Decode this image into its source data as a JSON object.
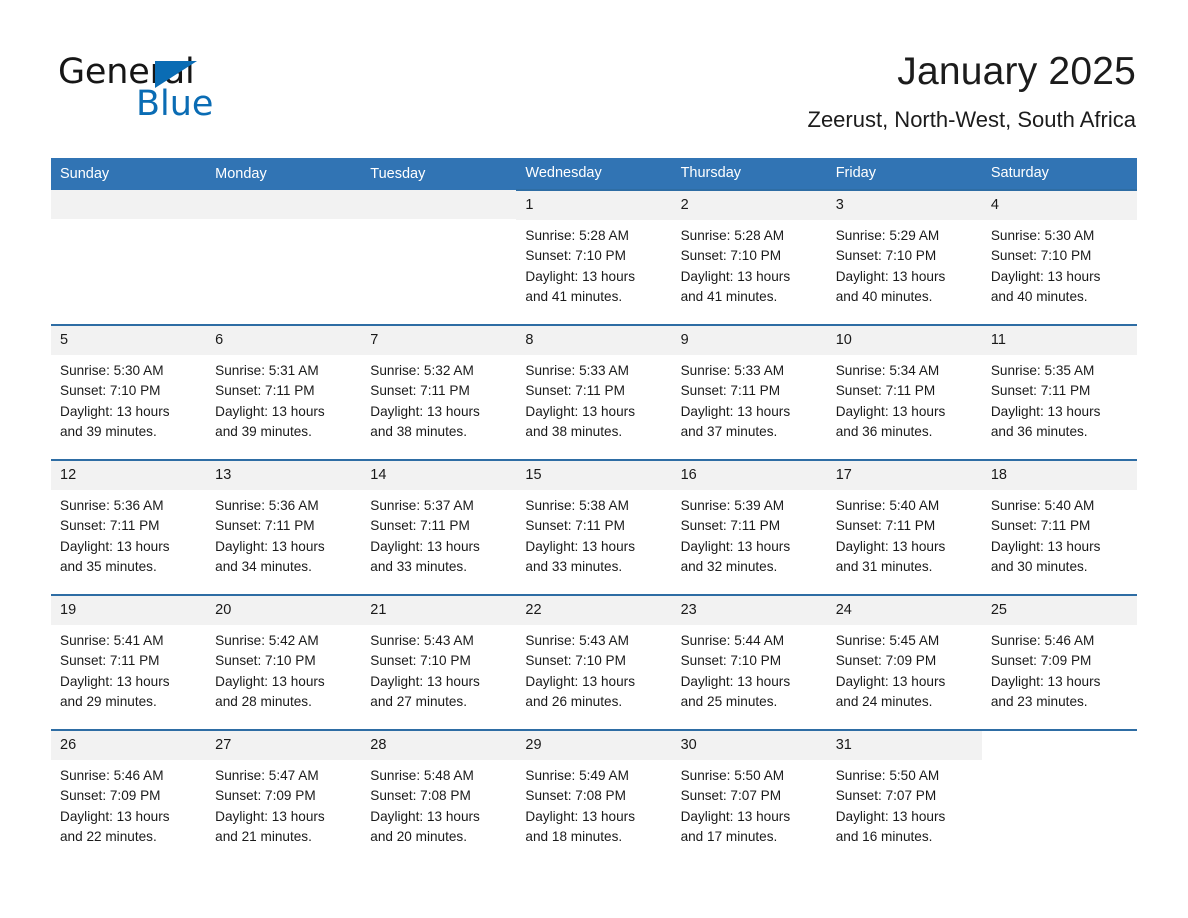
{
  "brand": {
    "name_part1": "General",
    "name_part2": "Blue",
    "logo_icon": "triangle-flag-icon",
    "primary_color": "#0a6cb4"
  },
  "header": {
    "title": "January 2025",
    "subtitle": "Zeerust, North-West, South Africa"
  },
  "theme": {
    "header_blue": "#3174b4",
    "row_rule_blue": "#2e6da4",
    "daynum_band": "#f2f2f2"
  },
  "calendar": {
    "weekday_headers": [
      "Sunday",
      "Monday",
      "Tuesday",
      "Wednesday",
      "Thursday",
      "Friday",
      "Saturday"
    ],
    "weeks": [
      [
        {
          "day": "",
          "lines": []
        },
        {
          "day": "",
          "lines": []
        },
        {
          "day": "",
          "lines": []
        },
        {
          "day": "1",
          "lines": [
            "Sunrise: 5:28 AM",
            "Sunset: 7:10 PM",
            "Daylight: 13 hours",
            "and 41 minutes."
          ]
        },
        {
          "day": "2",
          "lines": [
            "Sunrise: 5:28 AM",
            "Sunset: 7:10 PM",
            "Daylight: 13 hours",
            "and 41 minutes."
          ]
        },
        {
          "day": "3",
          "lines": [
            "Sunrise: 5:29 AM",
            "Sunset: 7:10 PM",
            "Daylight: 13 hours",
            "and 40 minutes."
          ]
        },
        {
          "day": "4",
          "lines": [
            "Sunrise: 5:30 AM",
            "Sunset: 7:10 PM",
            "Daylight: 13 hours",
            "and 40 minutes."
          ]
        }
      ],
      [
        {
          "day": "5",
          "lines": [
            "Sunrise: 5:30 AM",
            "Sunset: 7:10 PM",
            "Daylight: 13 hours",
            "and 39 minutes."
          ]
        },
        {
          "day": "6",
          "lines": [
            "Sunrise: 5:31 AM",
            "Sunset: 7:11 PM",
            "Daylight: 13 hours",
            "and 39 minutes."
          ]
        },
        {
          "day": "7",
          "lines": [
            "Sunrise: 5:32 AM",
            "Sunset: 7:11 PM",
            "Daylight: 13 hours",
            "and 38 minutes."
          ]
        },
        {
          "day": "8",
          "lines": [
            "Sunrise: 5:33 AM",
            "Sunset: 7:11 PM",
            "Daylight: 13 hours",
            "and 38 minutes."
          ]
        },
        {
          "day": "9",
          "lines": [
            "Sunrise: 5:33 AM",
            "Sunset: 7:11 PM",
            "Daylight: 13 hours",
            "and 37 minutes."
          ]
        },
        {
          "day": "10",
          "lines": [
            "Sunrise: 5:34 AM",
            "Sunset: 7:11 PM",
            "Daylight: 13 hours",
            "and 36 minutes."
          ]
        },
        {
          "day": "11",
          "lines": [
            "Sunrise: 5:35 AM",
            "Sunset: 7:11 PM",
            "Daylight: 13 hours",
            "and 36 minutes."
          ]
        }
      ],
      [
        {
          "day": "12",
          "lines": [
            "Sunrise: 5:36 AM",
            "Sunset: 7:11 PM",
            "Daylight: 13 hours",
            "and 35 minutes."
          ]
        },
        {
          "day": "13",
          "lines": [
            "Sunrise: 5:36 AM",
            "Sunset: 7:11 PM",
            "Daylight: 13 hours",
            "and 34 minutes."
          ]
        },
        {
          "day": "14",
          "lines": [
            "Sunrise: 5:37 AM",
            "Sunset: 7:11 PM",
            "Daylight: 13 hours",
            "and 33 minutes."
          ]
        },
        {
          "day": "15",
          "lines": [
            "Sunrise: 5:38 AM",
            "Sunset: 7:11 PM",
            "Daylight: 13 hours",
            "and 33 minutes."
          ]
        },
        {
          "day": "16",
          "lines": [
            "Sunrise: 5:39 AM",
            "Sunset: 7:11 PM",
            "Daylight: 13 hours",
            "and 32 minutes."
          ]
        },
        {
          "day": "17",
          "lines": [
            "Sunrise: 5:40 AM",
            "Sunset: 7:11 PM",
            "Daylight: 13 hours",
            "and 31 minutes."
          ]
        },
        {
          "day": "18",
          "lines": [
            "Sunrise: 5:40 AM",
            "Sunset: 7:11 PM",
            "Daylight: 13 hours",
            "and 30 minutes."
          ]
        }
      ],
      [
        {
          "day": "19",
          "lines": [
            "Sunrise: 5:41 AM",
            "Sunset: 7:11 PM",
            "Daylight: 13 hours",
            "and 29 minutes."
          ]
        },
        {
          "day": "20",
          "lines": [
            "Sunrise: 5:42 AM",
            "Sunset: 7:10 PM",
            "Daylight: 13 hours",
            "and 28 minutes."
          ]
        },
        {
          "day": "21",
          "lines": [
            "Sunrise: 5:43 AM",
            "Sunset: 7:10 PM",
            "Daylight: 13 hours",
            "and 27 minutes."
          ]
        },
        {
          "day": "22",
          "lines": [
            "Sunrise: 5:43 AM",
            "Sunset: 7:10 PM",
            "Daylight: 13 hours",
            "and 26 minutes."
          ]
        },
        {
          "day": "23",
          "lines": [
            "Sunrise: 5:44 AM",
            "Sunset: 7:10 PM",
            "Daylight: 13 hours",
            "and 25 minutes."
          ]
        },
        {
          "day": "24",
          "lines": [
            "Sunrise: 5:45 AM",
            "Sunset: 7:09 PM",
            "Daylight: 13 hours",
            "and 24 minutes."
          ]
        },
        {
          "day": "25",
          "lines": [
            "Sunrise: 5:46 AM",
            "Sunset: 7:09 PM",
            "Daylight: 13 hours",
            "and 23 minutes."
          ]
        }
      ],
      [
        {
          "day": "26",
          "lines": [
            "Sunrise: 5:46 AM",
            "Sunset: 7:09 PM",
            "Daylight: 13 hours",
            "and 22 minutes."
          ]
        },
        {
          "day": "27",
          "lines": [
            "Sunrise: 5:47 AM",
            "Sunset: 7:09 PM",
            "Daylight: 13 hours",
            "and 21 minutes."
          ]
        },
        {
          "day": "28",
          "lines": [
            "Sunrise: 5:48 AM",
            "Sunset: 7:08 PM",
            "Daylight: 13 hours",
            "and 20 minutes."
          ]
        },
        {
          "day": "29",
          "lines": [
            "Sunrise: 5:49 AM",
            "Sunset: 7:08 PM",
            "Daylight: 13 hours",
            "and 18 minutes."
          ]
        },
        {
          "day": "30",
          "lines": [
            "Sunrise: 5:50 AM",
            "Sunset: 7:07 PM",
            "Daylight: 13 hours",
            "and 17 minutes."
          ]
        },
        {
          "day": "31",
          "lines": [
            "Sunrise: 5:50 AM",
            "Sunset: 7:07 PM",
            "Daylight: 13 hours",
            "and 16 minutes."
          ]
        },
        {
          "day": "",
          "lines": []
        }
      ]
    ]
  }
}
